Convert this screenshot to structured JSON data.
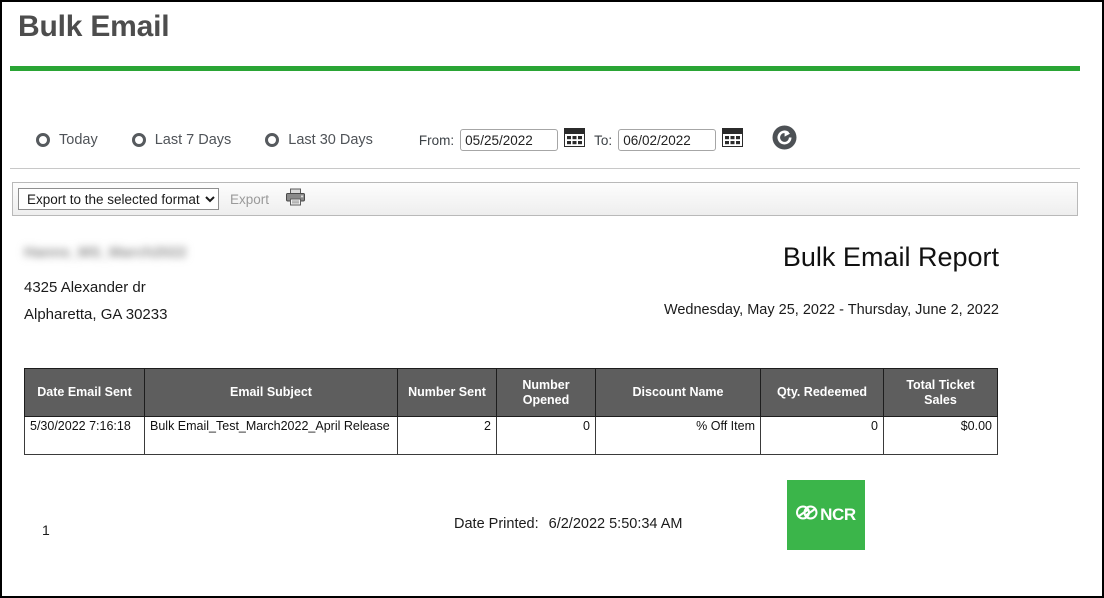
{
  "header": {
    "title": "Bulk Email",
    "accent_color": "#2aa535"
  },
  "filters": {
    "radios": [
      {
        "label": "Today",
        "selected": false
      },
      {
        "label": "Last 7 Days",
        "selected": false
      },
      {
        "label": "Last 30 Days",
        "selected": false
      }
    ],
    "from_label": "From:",
    "from_value": "05/25/2022",
    "to_label": "To:",
    "to_value": "06/02/2022",
    "calendar_icon": "calendar-icon",
    "refresh_icon": "refresh-icon"
  },
  "toolbar": {
    "export_format_selected": "Export to the selected format",
    "export_format_options": [
      "Export to the selected format"
    ],
    "export_label": "Export",
    "print_icon": "printer-icon"
  },
  "report": {
    "org_name_redacted": "Hanns_MS_March2022",
    "address_line1": "4325 Alexander dr",
    "address_line2": "Alpharetta, GA 30233",
    "title": "Bulk Email Report",
    "date_range": "Wednesday, May 25, 2022 - Thursday, June 2, 2022",
    "columns": [
      "Date Email Sent",
      "Email Subject",
      "Number Sent",
      "Number\nOpened",
      "Discount Name",
      "Qty. Redeemed",
      "Total Ticket\nSales"
    ],
    "columns_display": {
      "date_email_sent": "Date Email Sent",
      "email_subject": "Email Subject",
      "number_sent": "Number Sent",
      "number_opened_l1": "Number",
      "number_opened_l2": "Opened",
      "discount_name": "Discount Name",
      "qty_redeemed": "Qty. Redeemed",
      "total_ticket_l1": "Total Ticket",
      "total_ticket_l2": "Sales"
    },
    "rows": [
      {
        "date_email_sent": "5/30/2022 7:16:18",
        "email_subject": "Bulk Email_Test_March2022_April Release",
        "number_sent": "2",
        "number_opened": "0",
        "discount_name": "% Off Item",
        "qty_redeemed": "0",
        "total_ticket_sales": "$0.00"
      }
    ],
    "footer": {
      "page_number": "1",
      "date_printed_label": "Date Printed:",
      "date_printed_value": "6/2/2022 5:50:34 AM",
      "logo_text": "NCR",
      "logo_color": "#3bb54a"
    }
  }
}
